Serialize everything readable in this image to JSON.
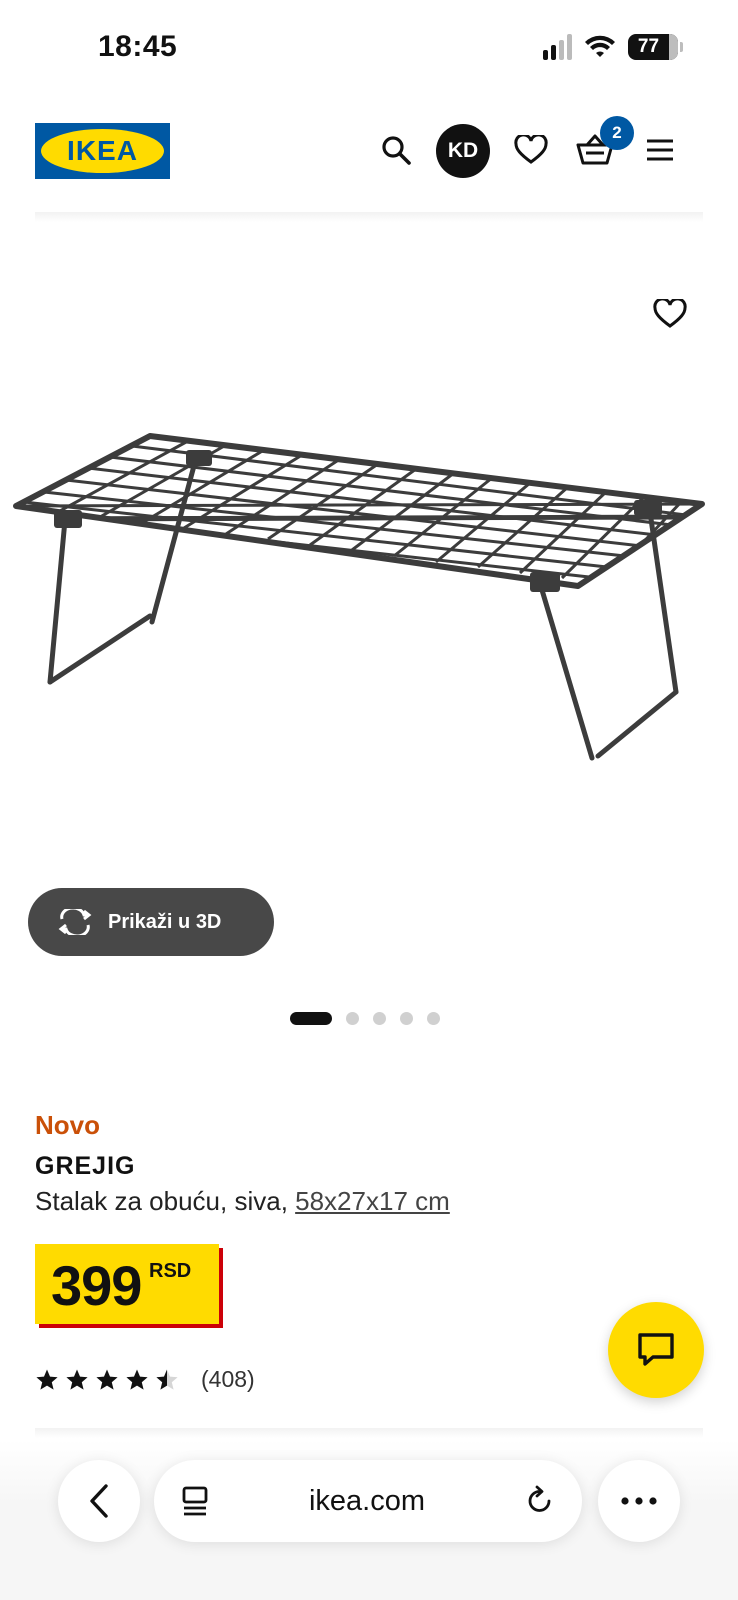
{
  "status_bar": {
    "time": "18:45",
    "battery": "77",
    "icons": [
      "signal-icon",
      "wifi-icon",
      "battery-icon"
    ]
  },
  "header": {
    "logo_text": "IKEA",
    "avatar_initials": "KD",
    "cart_count": "2",
    "icons": [
      "search-icon",
      "heart-icon",
      "basket-icon",
      "menu-icon"
    ]
  },
  "gallery": {
    "view_3d_label": "Prikaži u 3D",
    "dots_total": 5,
    "active_dot": 1
  },
  "product": {
    "badge": "Novo",
    "name": "GREJIG",
    "description": "Stalak za obuću, siva, ",
    "dimensions": "58x27x17 cm",
    "price": "399",
    "currency": "RSD",
    "rating": 4.5,
    "review_count": "(408)"
  },
  "browser": {
    "url": "ikea.com",
    "icons": [
      "back-icon",
      "tabs-icon",
      "reload-icon",
      "more-icon"
    ]
  },
  "colors": {
    "brand_blue": "#0058a3",
    "brand_yellow": "#ffdb00",
    "price_shadow": "#cc0008",
    "new_badge": "#ca5008"
  }
}
